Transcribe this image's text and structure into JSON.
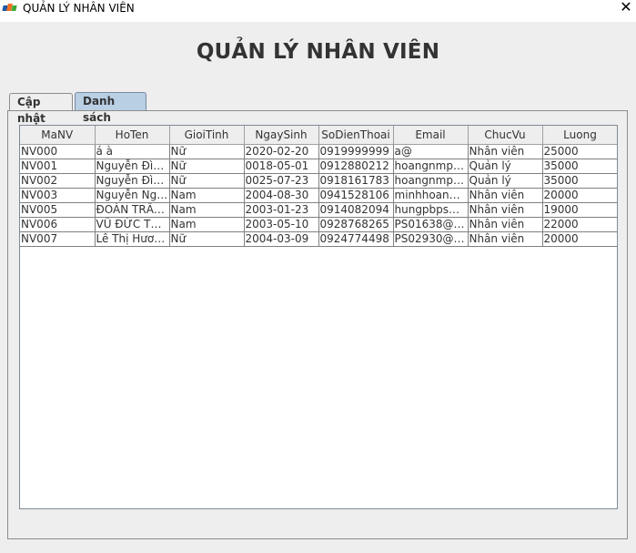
{
  "window": {
    "title": "QUẢN LÝ NHÂN VIÊN",
    "close_glyph": "✕",
    "icon": "fpt-logo-icon",
    "icon_colors": [
      "#1b5aa6",
      "#f36f21",
      "#3aaa35"
    ]
  },
  "heading": "QUẢN LÝ NHÂN VIÊN",
  "tabs": [
    {
      "label": "Cập nhật",
      "selected": false
    },
    {
      "label": "Danh sách",
      "selected": true
    }
  ],
  "table": {
    "columns": [
      "MaNV",
      "HoTen",
      "GioiTinh",
      "NgaySinh",
      "SoDienThoai",
      "Email",
      "ChucVu",
      "Luong"
    ],
    "rows": [
      [
        "NV000",
        "á à",
        "Nữ",
        "2020-02-20",
        "0919999999",
        "a@",
        "Nhân viên",
        "25000"
      ],
      [
        "NV001",
        "Nguyễn Đìn...",
        "Nữ",
        "0018-05-01",
        "0912880212",
        "hoangnmps...",
        "Quản lý",
        "35000"
      ],
      [
        "NV002",
        "Nguyễn Đìn...",
        "Nữ",
        "0025-07-23",
        "0918161783",
        "hoangnmps...",
        "Quản lý",
        "35000"
      ],
      [
        "NV003",
        "Nguyễn Ngh...",
        "Nam",
        "2004-08-30",
        "0941528106",
        "minhhoang2...",
        "Nhân viên",
        "20000"
      ],
      [
        "NV005",
        "ĐOÀN TRẦN...",
        "Nam",
        "2003-01-23",
        "0914082094",
        "hungpbps26...",
        "Nhân viên",
        "19000"
      ],
      [
        "NV006",
        "VŨ ĐỨC TU...",
        "Nam",
        "2003-05-10",
        "0928768265",
        "PS01638@f...",
        "Nhân viên",
        "22000"
      ],
      [
        "NV007",
        "Lê Thị Hươn...",
        "Nữ",
        "2004-03-09",
        "0924774498",
        "PS02930@f...",
        "Nhân viên",
        "20000"
      ]
    ]
  }
}
